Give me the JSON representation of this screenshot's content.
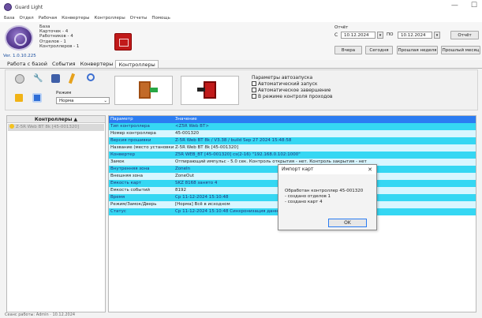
{
  "window": {
    "title": "Guard Light",
    "minimize": "—",
    "maximize": "☐"
  },
  "menu": [
    "База",
    "Отдел",
    "Рабочая",
    "Конвертеры",
    "Контроллеры",
    "Отчеты",
    "Помощь"
  ],
  "info": {
    "heading": "База",
    "stats": [
      "Карточек - 4",
      "Работников - 4",
      "Отделов - 1",
      "Контроллеров - 1"
    ],
    "version": "Ver. 1.0.10.225"
  },
  "period": {
    "label": "Отчёт",
    "from_prefix": "С",
    "from_date": "10.12.2024",
    "to_prefix": "ПО",
    "to_date": "10.12.2024",
    "report_btn": "Отчёт",
    "yesterday_btn": "Вчера",
    "today_btn": "Сегодня",
    "lastweek_btn": "Прошлая неделя",
    "lastmonth_btn": "Прошлый месяц"
  },
  "tabs": [
    "Работа с базой",
    "События",
    "Конвертеры",
    "Контроллеры"
  ],
  "toolbar": {
    "mode_label": "Режим",
    "mode_value": "Норма",
    "autostart_title": "Параметры автозапуска",
    "autostart_options": [
      "Автоматический запуск",
      "Автоматическое завершение",
      "В режиме контроля проходов"
    ]
  },
  "left_panel": {
    "header": "Контроллеры ▲",
    "items": [
      "Z-5R Web BT 8k [45-001320]"
    ]
  },
  "grid": {
    "headers": [
      "Параметр",
      "Значение"
    ],
    "rows": [
      [
        "Тип контроллера",
        "<Z5R Web BT>"
      ],
      [
        "Номер контроллера",
        "45-001320"
      ],
      [
        "Версия прошивки",
        "Z-5R Web BT 8k / V3.38 / build Sep 27 2024 15:48:58"
      ],
      [
        "Название (место установки)",
        "Z-5R Web BT 8k [45-001320]"
      ],
      [
        "Конвертер",
        "Z5R WEB_BT [45-001320] cs(2-16) \"192.168.0.102:1000\""
      ],
      [
        "Замок",
        "Отпирающий импульс - 5.0 сек. Контроль открытия - нет. Контроль закрытия - нет"
      ],
      [
        "Внутренняя зона",
        "ZoneIn"
      ],
      [
        "Внешняя зона",
        "ZoneOut"
      ],
      [
        "Емкость карт",
        "SKZ 8168 занято 4"
      ],
      [
        "Емкость событий",
        "8192"
      ],
      [
        "Время",
        "Ср 11-12-2024 15:10:48"
      ],
      [
        "Режим/Замок/Дверь",
        "[Норма] Всё в исходном"
      ],
      [
        "Статус",
        "Ср 11-12-2024 15:10:48 Синхронизация данных (C)"
      ]
    ]
  },
  "dialog": {
    "title": "Импорт карт",
    "close": "✕",
    "lines": [
      "Обработан контроллер 45-001320",
      " - создано отделов 1",
      " - создано карт 4"
    ],
    "ok_label": "OK"
  },
  "statusbar": "Сеанс работы: Admin · 10.12.2024"
}
